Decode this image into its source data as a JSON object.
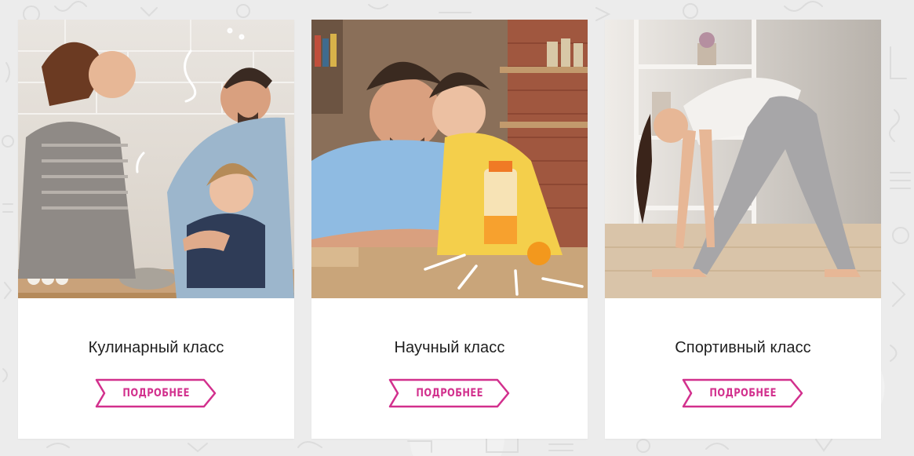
{
  "cards": [
    {
      "title": "Кулинарный класс",
      "button_label": "ПОДРОБНЕЕ",
      "photo_subject": "family baking in kitchen"
    },
    {
      "title": "Научный класс",
      "button_label": "ПОДРОБНЕЕ",
      "photo_subject": "father and son experiment with juicer"
    },
    {
      "title": "Спортивный класс",
      "button_label": "ПОДРОБНЕЕ",
      "photo_subject": "girl stretching yoga"
    }
  ],
  "colors": {
    "accent": "#d2308d",
    "background": "#ececec",
    "card": "#ffffff",
    "title_text": "#1e1e1e"
  }
}
